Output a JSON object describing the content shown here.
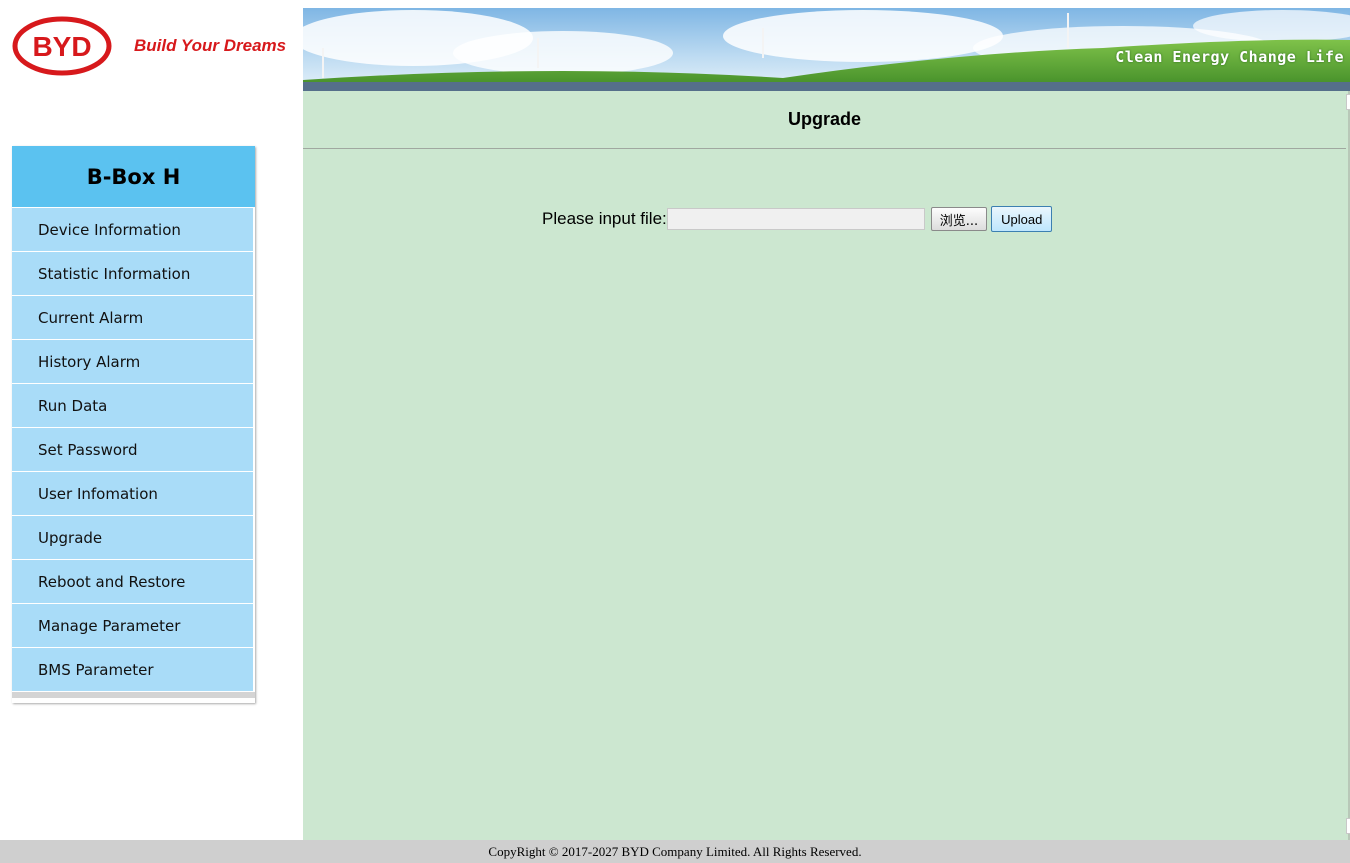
{
  "brand": {
    "logo_text": "BYD",
    "tagline": "Build Your Dreams",
    "logo_color": "#d7191c"
  },
  "banner": {
    "slogan": "Clean Energy Change Life"
  },
  "sidebar": {
    "title": "B-Box H",
    "accent": "#5bc2f0",
    "item_bg": "#a9dcf8",
    "items": [
      {
        "label": "Device Information"
      },
      {
        "label": "Statistic Information"
      },
      {
        "label": "Current Alarm"
      },
      {
        "label": "History Alarm"
      },
      {
        "label": "Run Data"
      },
      {
        "label": "Set Password"
      },
      {
        "label": "User Infomation"
      },
      {
        "label": "Upgrade"
      },
      {
        "label": "Reboot and Restore"
      },
      {
        "label": "Manage Parameter"
      },
      {
        "label": "BMS Parameter"
      }
    ]
  },
  "main": {
    "title": "Upgrade",
    "background": "#cce7d0",
    "upload": {
      "label": "Please input file:",
      "file_value": "",
      "browse_label": "浏览...",
      "upload_label": "Upload"
    }
  },
  "footer": {
    "text": "CopyRight © 2017-2027 BYD Company Limited. All Rights Reserved."
  }
}
